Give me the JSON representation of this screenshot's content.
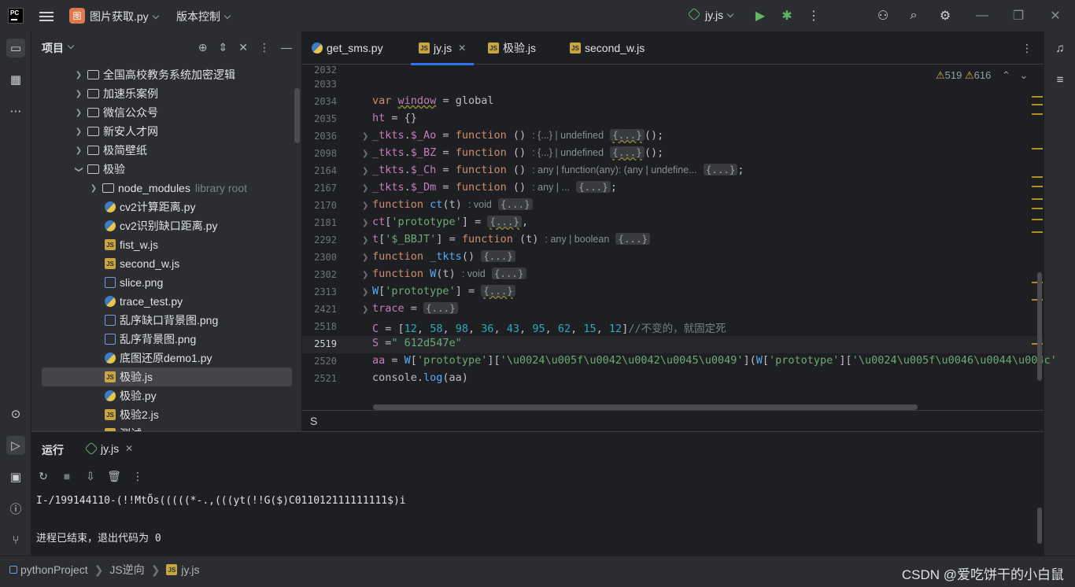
{
  "titlebar": {
    "logo": "PC",
    "project_badge": "图",
    "project_name": "图片获取.py",
    "vcs": "版本控制",
    "run_config": "jy.js"
  },
  "project_panel": {
    "title": "项目",
    "items": [
      {
        "label": "全国高校教务系统加密逻辑",
        "type": "folder",
        "expanded": false
      },
      {
        "label": "加速乐案例",
        "type": "folder",
        "expanded": false
      },
      {
        "label": "微信公众号",
        "type": "folder",
        "expanded": false
      },
      {
        "label": "新安人才网",
        "type": "folder",
        "expanded": false
      },
      {
        "label": "极简壁纸",
        "type": "folder",
        "expanded": false
      },
      {
        "label": "极验",
        "type": "folder",
        "expanded": true
      },
      {
        "label": "node_modules",
        "hint": "library root",
        "type": "folder",
        "expanded": false
      },
      {
        "label": "cv2计算距离.py",
        "type": "py"
      },
      {
        "label": "cv2识别缺口距离.py",
        "type": "py"
      },
      {
        "label": "fist_w.js",
        "type": "js"
      },
      {
        "label": "second_w.js",
        "type": "js"
      },
      {
        "label": "slice.png",
        "type": "png"
      },
      {
        "label": "trace_test.py",
        "type": "py"
      },
      {
        "label": "乱序缺口背景图.png",
        "type": "png"
      },
      {
        "label": "乱序背景图.png",
        "type": "png"
      },
      {
        "label": "底图还原demo1.py",
        "type": "py"
      },
      {
        "label": "极验.js",
        "type": "js",
        "selected": true
      },
      {
        "label": "极验.py",
        "type": "py"
      },
      {
        "label": "极验2.js",
        "type": "js"
      },
      {
        "label": "测试",
        "type": "js"
      }
    ]
  },
  "editor": {
    "tabs": [
      {
        "label": "get_sms.py",
        "type": "py",
        "active": false
      },
      {
        "label": "jy.js",
        "type": "js",
        "active": true
      },
      {
        "label": "极验.js",
        "type": "js",
        "active": false
      },
      {
        "label": "second_w.js",
        "type": "js",
        "active": false
      }
    ],
    "warnings": "519",
    "weak_warnings": "616",
    "line_numbers": [
      "2032",
      "2033",
      "2034",
      "2035",
      "2036",
      "2098",
      "2164",
      "2167",
      "2170",
      "2181",
      "2292",
      "2300",
      "2302",
      "2313",
      "2421",
      "2518",
      "2519",
      "2520",
      "2521"
    ],
    "current_line": "2519",
    "inlay": {
      "ao": ": {...} | undefined",
      "bz": ": {...} | undefined",
      "ch": ": any | function(any): (any | undefine...",
      "dm": ": any | ...",
      "ct": ": void",
      "bbjt": ": any | boolean",
      "w": ": void"
    },
    "collapsed": "{...}",
    "comment": "//不变的，就固定死",
    "c_values": [
      "12",
      "58",
      "98",
      "36",
      "43",
      "95",
      "62",
      "15",
      "12"
    ],
    "s_value": "\" 612d547e\"",
    "search_text": "S"
  },
  "run_panel": {
    "title": "运行",
    "tab": "jy.js",
    "output_line1": "I-/199144110-(!!MtÕs(((((*-.,(((yt(!!G($)C011012111111111$)i",
    "output_line2": "进程已结束，退出代码为 0"
  },
  "statusbar": {
    "crumbs": [
      "pythonProject",
      "JS逆向",
      "jy.js"
    ],
    "watermark": "CSDN @爱吃饼干的小白鼠"
  }
}
